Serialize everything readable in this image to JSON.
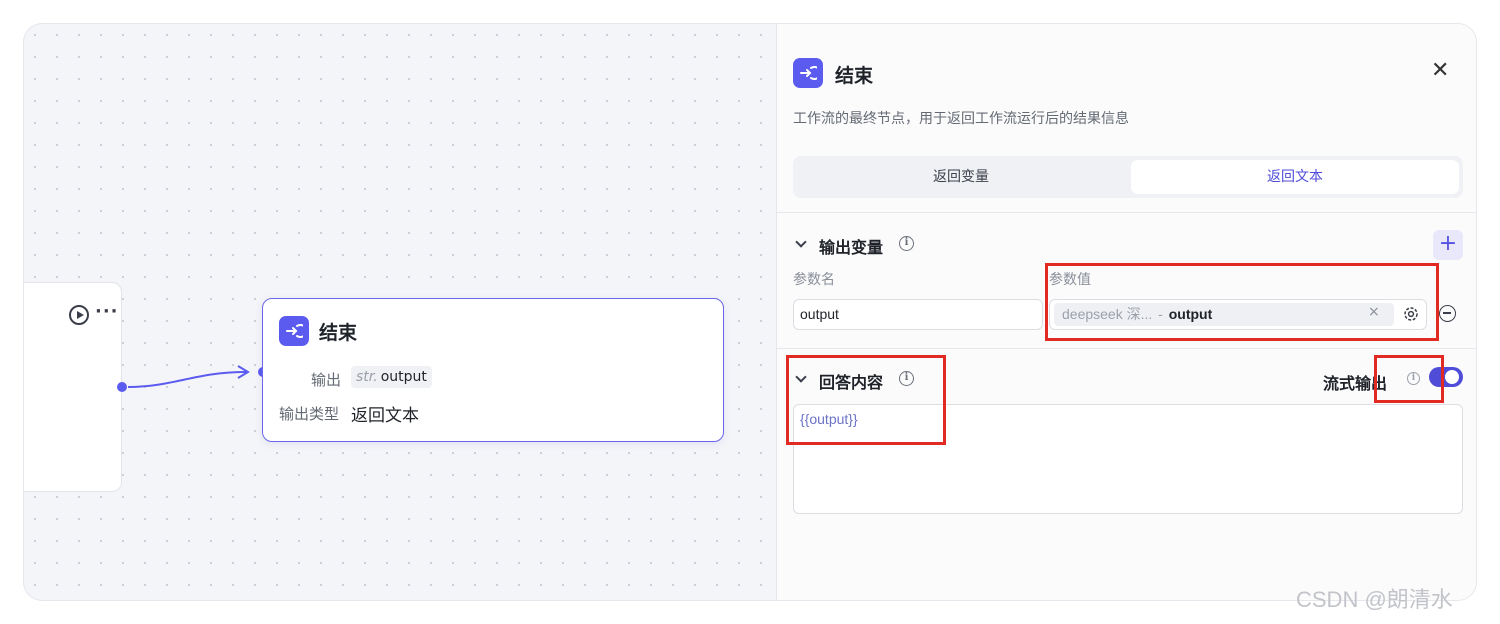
{
  "canvas": {
    "end_node": {
      "title": "结束",
      "output_label": "输出",
      "output_type_tag": "str.",
      "output_var": "output",
      "output_type_label": "输出类型",
      "output_type_value": "返回文本"
    }
  },
  "panel": {
    "title": "结束",
    "close_symbol": "✕",
    "description": "工作流的最终节点，用于返回工作流运行后的结果信息",
    "tabs": [
      {
        "label": "返回变量",
        "active": false
      },
      {
        "label": "返回文本",
        "active": true
      }
    ],
    "output_section": {
      "title": "输出变量",
      "add_symbol": "+",
      "col_name": "参数名",
      "col_value": "参数值",
      "row": {
        "name": "output",
        "value_source": "deepseek 深...",
        "value_sep": "-",
        "value_var": "output",
        "clear_symbol": "×"
      }
    },
    "answer_section": {
      "title": "回答内容",
      "stream_label": "流式输出",
      "stream_enabled": true,
      "content": "{{output}}"
    }
  },
  "watermark": "CSDN @朗清水",
  "colors": {
    "accent": "#5b5bf0",
    "highlight_box": "#e02a22"
  }
}
